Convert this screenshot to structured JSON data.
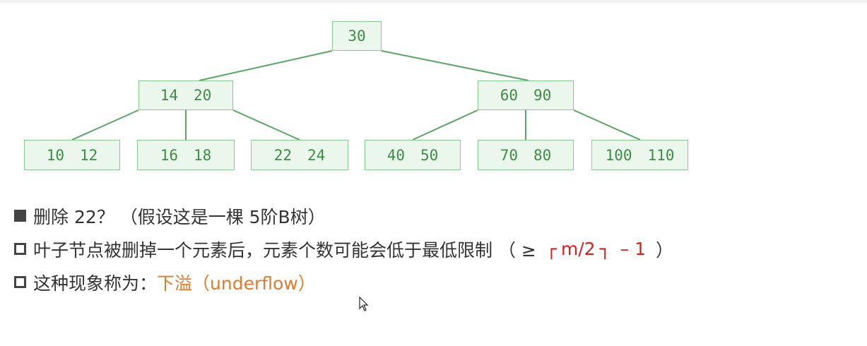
{
  "tree": {
    "root": [
      "30"
    ],
    "level1": [
      [
        "14",
        "20"
      ],
      [
        "60",
        "90"
      ]
    ],
    "leaves": [
      [
        "10",
        "12"
      ],
      [
        "16",
        "18"
      ],
      [
        "22",
        "24"
      ],
      [
        "40",
        "50"
      ],
      [
        "70",
        "80"
      ],
      [
        "100",
        "110"
      ]
    ]
  },
  "colors": {
    "node_fill": "#ebf7ec",
    "node_border": "#86c98d",
    "node_text": "#3e8c47",
    "edge": "#5aa563",
    "formula_red": "#e01d1d",
    "highlight_orange": "#e07a2e"
  },
  "bullets": {
    "b1": {
      "icon": "filled-square-bullet",
      "text": "删除 22？ （假设这是一棵 5阶B树）"
    },
    "b2": {
      "icon": "hollow-square-bullet",
      "text": "叶子节点被删掉一个元素后，元素个数可能会低于最低限制 （ ≥",
      "formula_open": "┌",
      "formula": "m/2",
      "formula_close": "┐",
      "formula_tail": "– 1",
      "paren_close": "）"
    },
    "b3": {
      "icon": "hollow-square-bullet",
      "text": "这种现象称为：",
      "term": "下溢（underflow）"
    }
  },
  "cursor_icon": "mouse-pointer-icon"
}
